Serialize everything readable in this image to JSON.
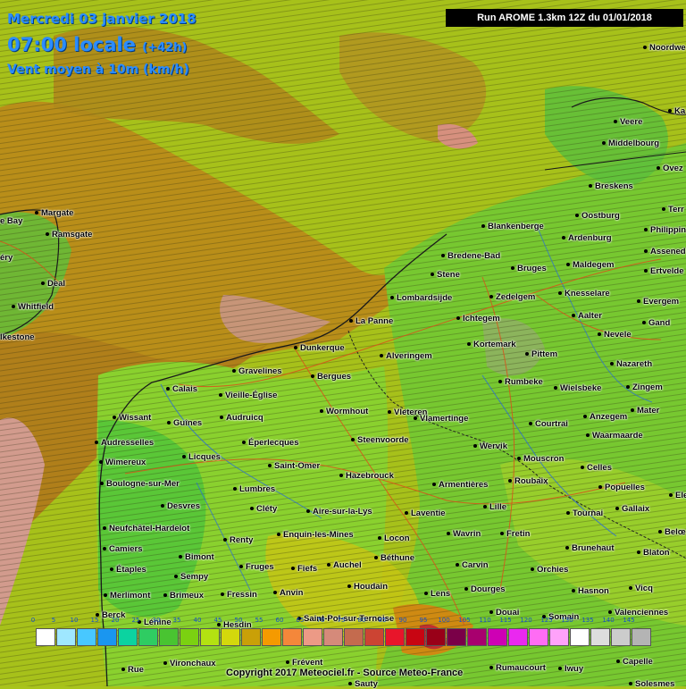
{
  "header": {
    "date": "Mercredi 03 janvier 2018",
    "time": "07:00 locale",
    "offset": "(+42h)",
    "parameter": "Vent moyen à 10m (km/h)"
  },
  "run_label": "Run AROME 1.3km 12Z du 01/01/2018",
  "copyright": "Copyright 2017 Meteociel.fr - Source Meteo-France",
  "legend": {
    "ticks": [
      "0",
      "5",
      "10",
      "15",
      "20",
      "25",
      "30",
      "35",
      "40",
      "45",
      "50",
      "55",
      "60",
      "65",
      "70",
      "75",
      "80",
      "85",
      "90",
      "95",
      "100",
      "105",
      "110",
      "115",
      "120",
      "125",
      "130",
      "135",
      "140",
      "145"
    ],
    "colors": [
      "#ffffff",
      "#9fe7ff",
      "#48c8ff",
      "#1a96f0",
      "#0bd3a0",
      "#2fcc62",
      "#49c431",
      "#7bd111",
      "#b3e211",
      "#d4d80c",
      "#c9a008",
      "#f59a00",
      "#f4873a",
      "#ec9a86",
      "#d58a7a",
      "#c46b4e",
      "#cc4433",
      "#e8152a",
      "#c80512",
      "#990018",
      "#7a0048",
      "#a8006e",
      "#ce00b4",
      "#ea28f0",
      "#ff6cf4",
      "#ffa2fa",
      "#ffffff",
      "#dddddd",
      "#cccccc",
      "#b4b4b4"
    ]
  },
  "cities": [
    {
      "name": "Noordwe"
    },
    {
      "name": "Veere"
    },
    {
      "name": "Middelbourg"
    },
    {
      "name": "Ovez"
    },
    {
      "name": "Breskens"
    },
    {
      "name": "Terr"
    },
    {
      "name": "Oostburg"
    },
    {
      "name": "Philippin"
    },
    {
      "name": "Blankenberge"
    },
    {
      "name": "Ardenburg"
    },
    {
      "name": "Assened"
    },
    {
      "name": "Bredene-Bad"
    },
    {
      "name": "Maldegem"
    },
    {
      "name": "Stene"
    },
    {
      "name": "Bruges"
    },
    {
      "name": "Ertvelde"
    },
    {
      "name": "Margate"
    },
    {
      "name": "Ramsgate"
    },
    {
      "name": "Deal"
    },
    {
      "name": "Whitfield"
    },
    {
      "name": "lkestone"
    },
    {
      "name": "Lombardsijde"
    },
    {
      "name": "Zedelgem"
    },
    {
      "name": "Knesselare"
    },
    {
      "name": "Evergem"
    },
    {
      "name": "Aalter"
    },
    {
      "name": "Gand"
    },
    {
      "name": "La Panne"
    },
    {
      "name": "Ichtegem"
    },
    {
      "name": "Kortemark"
    },
    {
      "name": "Nevele"
    },
    {
      "name": "Dunkerque"
    },
    {
      "name": "Alveringem"
    },
    {
      "name": "Pittem"
    },
    {
      "name": "Nazareth"
    },
    {
      "name": "Gravelines"
    },
    {
      "name": "Bergues"
    },
    {
      "name": "Rumbeke"
    },
    {
      "name": "Wielsbeke"
    },
    {
      "name": "Zingem"
    },
    {
      "name": "Calais"
    },
    {
      "name": "Vieille-Église"
    },
    {
      "name": "Vleteren"
    },
    {
      "name": "Mater"
    },
    {
      "name": "Wormhout"
    },
    {
      "name": "Anzegem"
    },
    {
      "name": "Wissant"
    },
    {
      "name": "Guînes"
    },
    {
      "name": "Audruicq"
    },
    {
      "name": "Vlamertinge"
    },
    {
      "name": "Courtrai"
    },
    {
      "name": "Steenvoorde"
    },
    {
      "name": "Waarmaarde"
    },
    {
      "name": "Audresselles"
    },
    {
      "name": "Éperlecques"
    },
    {
      "name": "Wervik"
    },
    {
      "name": "Mouscron"
    },
    {
      "name": "Wimereux"
    },
    {
      "name": "Licques"
    },
    {
      "name": "Saint-Omer"
    },
    {
      "name": "Celles"
    },
    {
      "name": "Hazebrouck"
    },
    {
      "name": "Roubaix"
    },
    {
      "name": "Boulogne-sur-Mer"
    },
    {
      "name": "Lumbres"
    },
    {
      "name": "Armentières"
    },
    {
      "name": "Popuelles"
    },
    {
      "name": "Desvres"
    },
    {
      "name": "Lille"
    },
    {
      "name": "Cléty"
    },
    {
      "name": "Aire-sur-la-Lys"
    },
    {
      "name": "Laventie"
    },
    {
      "name": "Tournai"
    },
    {
      "name": "Gallaix"
    },
    {
      "name": "Neufchâtel-Hardelot"
    },
    {
      "name": "Renty"
    },
    {
      "name": "Enquin-les-Mines"
    },
    {
      "name": "Locon"
    },
    {
      "name": "Wavrin"
    },
    {
      "name": "Fretin"
    },
    {
      "name": "Camiers"
    },
    {
      "name": "Bimont"
    },
    {
      "name": "Brunehaut"
    },
    {
      "name": "Blaton"
    },
    {
      "name": "Béthune"
    },
    {
      "name": "Étaples"
    },
    {
      "name": "Fruges"
    },
    {
      "name": "Fiefs"
    },
    {
      "name": "Auchel"
    },
    {
      "name": "Carvin"
    },
    {
      "name": "Orchies"
    },
    {
      "name": "Sempy"
    },
    {
      "name": "Merlimont"
    },
    {
      "name": "Brimeux"
    },
    {
      "name": "Fressin"
    },
    {
      "name": "Anvin"
    },
    {
      "name": "Houdain"
    },
    {
      "name": "Lens"
    },
    {
      "name": "Dourges"
    },
    {
      "name": "Hasnon"
    },
    {
      "name": "Vicq"
    },
    {
      "name": "Berck"
    },
    {
      "name": "Douai"
    },
    {
      "name": "Somain"
    },
    {
      "name": "Valenciennes"
    },
    {
      "name": "Lénine"
    },
    {
      "name": "Hesdin"
    },
    {
      "name": "Saint-Pol-sur-Ternoise"
    },
    {
      "name": "Rue"
    },
    {
      "name": "Vironchaux"
    },
    {
      "name": "Frévent"
    },
    {
      "name": "Rumaucourt"
    },
    {
      "name": "Iwuy"
    },
    {
      "name": "Capelle"
    },
    {
      "name": "Sauty"
    },
    {
      "name": "Solesmes"
    },
    {
      "name": "e Bay"
    },
    {
      "name": "éry"
    },
    {
      "name": "Ka"
    },
    {
      "name": "Belœ"
    },
    {
      "name": "Ele"
    }
  ]
}
